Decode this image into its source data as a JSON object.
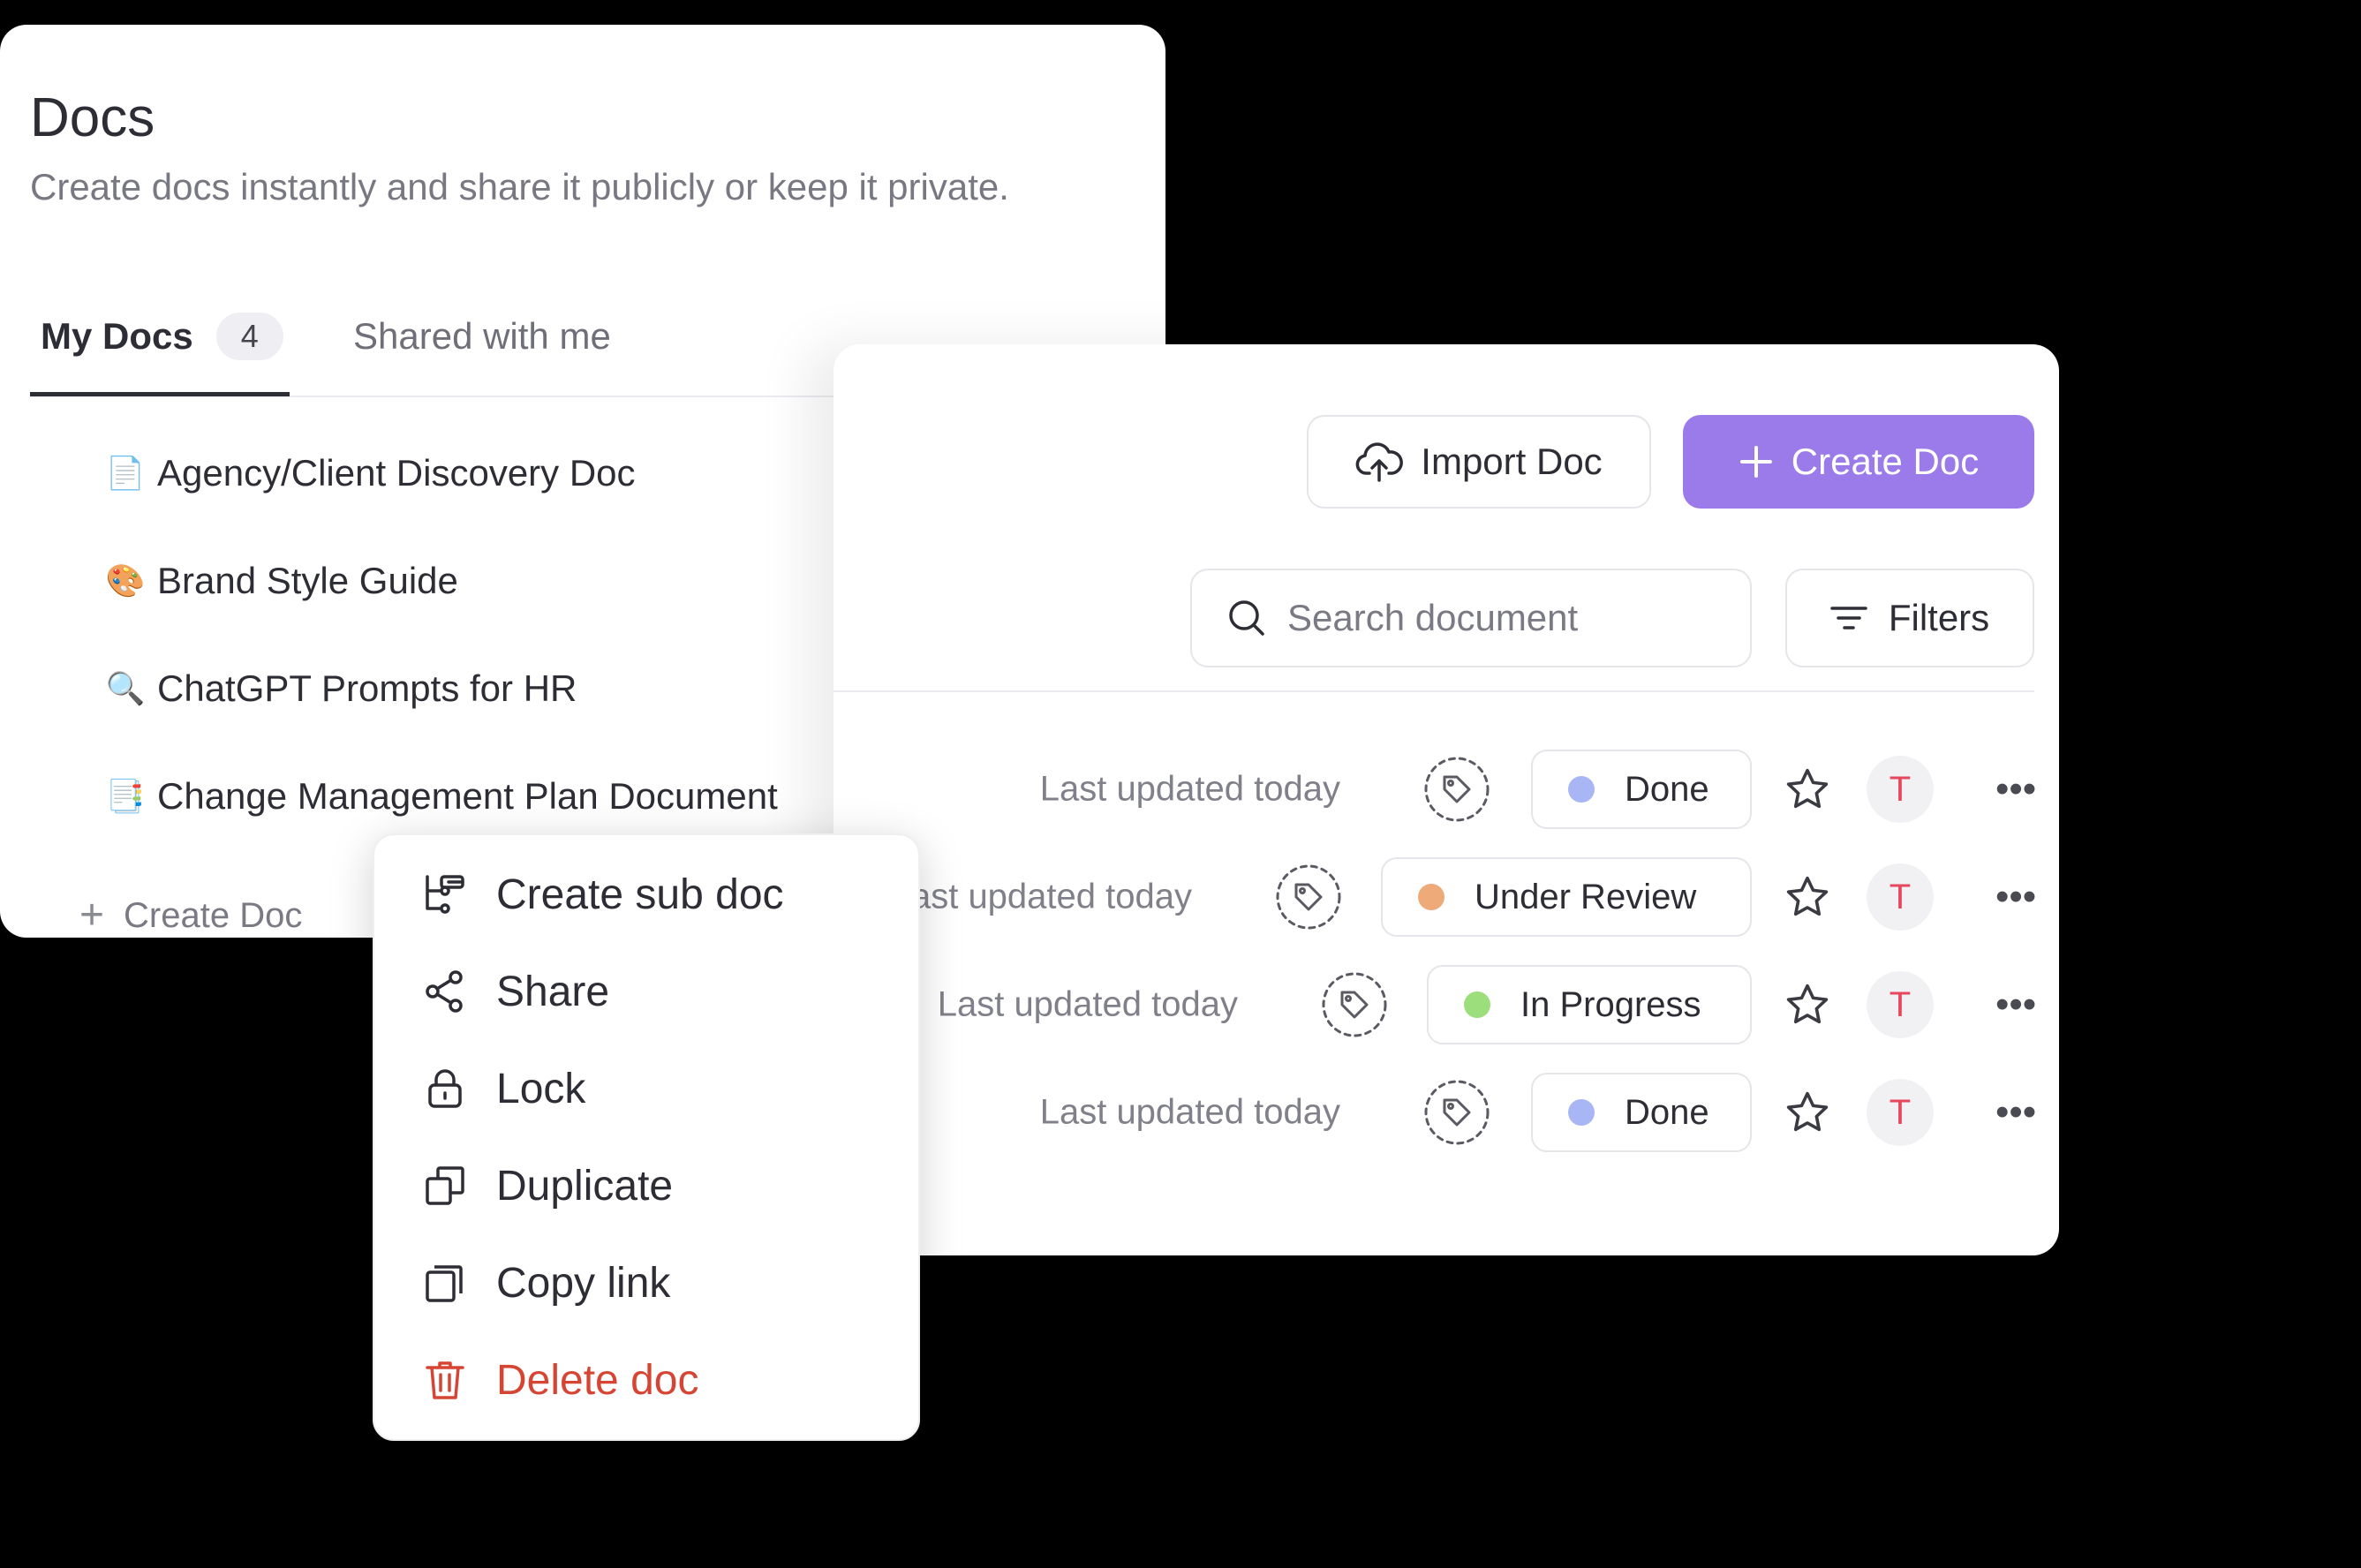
{
  "docs": {
    "title": "Docs",
    "subtitle": "Create docs instantly and share it publicly or keep it private.",
    "tabs": [
      {
        "label": "My Docs",
        "count": "4"
      },
      {
        "label": "Shared with me"
      }
    ],
    "items": [
      {
        "emoji": "📄",
        "name": "Agency/Client Discovery Doc"
      },
      {
        "emoji": "🎨",
        "name": "Brand Style Guide"
      },
      {
        "emoji": "🔍",
        "name": "ChatGPT Prompts for HR"
      },
      {
        "emoji": "📑",
        "name": "Change Management Plan Document"
      }
    ],
    "create_label": "Create Doc"
  },
  "toolbar": {
    "import_label": "Import Doc",
    "create_label": "Create Doc",
    "search_placeholder": "Search document",
    "filters_label": "Filters"
  },
  "rows": [
    {
      "updated": "Last updated today",
      "status": "Done",
      "status_color": "#a9b6f5",
      "avatar": "T"
    },
    {
      "updated": "Last updated today",
      "status": "Under Review",
      "status_color": "#eeaa78",
      "avatar": "T"
    },
    {
      "updated": "Last updated today",
      "status": "In Progress",
      "status_color": "#9dde7c",
      "avatar": "T"
    },
    {
      "updated": "Last updated today",
      "status": "Done",
      "status_color": "#a9b6f5",
      "avatar": "T"
    }
  ],
  "context_menu": [
    {
      "label": "Create sub doc",
      "icon": "subdoc-icon"
    },
    {
      "label": "Share",
      "icon": "share-icon"
    },
    {
      "label": "Lock",
      "icon": "lock-icon"
    },
    {
      "label": "Duplicate",
      "icon": "duplicate-icon"
    },
    {
      "label": "Copy link",
      "icon": "copy-link-icon"
    },
    {
      "label": "Delete doc",
      "icon": "trash-icon",
      "danger": true
    }
  ],
  "colors": {
    "accent": "#9b7bea",
    "danger": "#d64533",
    "avatar_text": "#e6475d"
  }
}
